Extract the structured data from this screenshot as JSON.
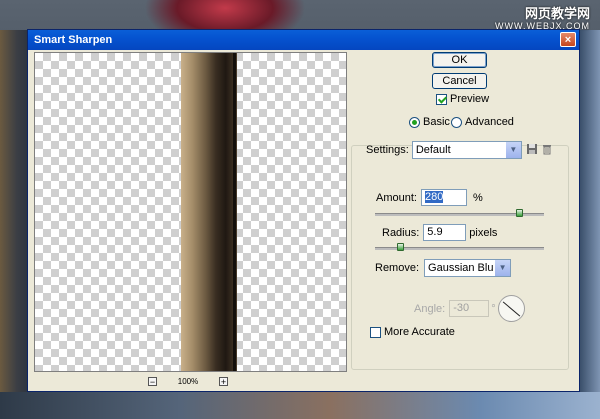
{
  "window": {
    "title": "Smart Sharpen",
    "close_glyph": "×"
  },
  "watermark": {
    "line1": "网页教学网",
    "line2": "WWW.WEBJX.COM"
  },
  "buttons": {
    "ok_label": "OK",
    "cancel_label": "Cancel"
  },
  "preview_checkbox": {
    "label": "Preview",
    "checked": true
  },
  "mode": {
    "basic_label": "Basic",
    "advanced_label": "Advanced",
    "selected": "Basic"
  },
  "settings": {
    "label": "Settings:",
    "value": "Default",
    "save_icon": "disk-icon",
    "delete_icon": "trash-icon"
  },
  "amount": {
    "label": "Amount:",
    "value": "280",
    "unit": "%",
    "slider_fraction": 0.85
  },
  "radius": {
    "label": "Radius:",
    "value": "5.9",
    "unit": "pixels",
    "slider_fraction": 0.15
  },
  "remove": {
    "label": "Remove:",
    "value": "Gaussian Blur"
  },
  "angle": {
    "label": "Angle:",
    "value": "-30",
    "unit": "°"
  },
  "more_accurate": {
    "label": "More Accurate",
    "checked": false
  },
  "zoom": {
    "minus": "−",
    "plus": "+",
    "level": "100%"
  }
}
